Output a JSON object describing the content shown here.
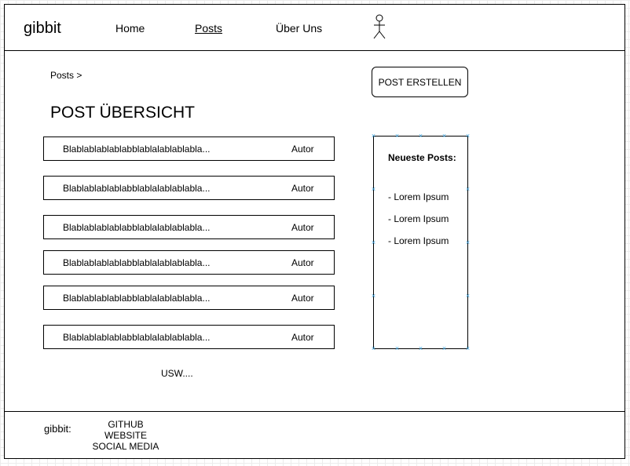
{
  "header": {
    "logo": "gibbit",
    "nav": [
      {
        "label": "Home",
        "active": false
      },
      {
        "label": "Posts",
        "active": true
      },
      {
        "label": "Über Uns",
        "active": false
      }
    ],
    "user_icon": "stick-figure-user-icon"
  },
  "breadcrumb": "Posts >",
  "page_title": "POST ÜBERSICHT",
  "create_button": "POST ERSTELLEN",
  "posts": [
    {
      "text": "Blablablablablabblablalablablabla...",
      "author": "Autor"
    },
    {
      "text": "Blablablablablabblablalablablabla...",
      "author": "Autor"
    },
    {
      "text": "Blablablablablabblablalablablabla...",
      "author": "Autor"
    },
    {
      "text": "Blablablablablabblablalablablabla...",
      "author": "Autor"
    },
    {
      "text": "Blablablablablabblablalablablabla...",
      "author": "Autor"
    },
    {
      "text": "Blablablablablabblablalablablabla...",
      "author": "Autor"
    }
  ],
  "more_label": "USW....",
  "latest": {
    "title": "Neueste Posts:",
    "items": [
      "- Lorem Ipsum",
      "- Lorem Ipsum",
      "- Lorem Ipsum"
    ]
  },
  "footer": {
    "brand": "gibbit:",
    "links": [
      "GITHUB",
      "WEBSITE",
      "SOCIAL MEDIA"
    ]
  },
  "colors": {
    "selection_handle": "#3ba3e0",
    "border": "#000000",
    "grid": "#ececec"
  }
}
